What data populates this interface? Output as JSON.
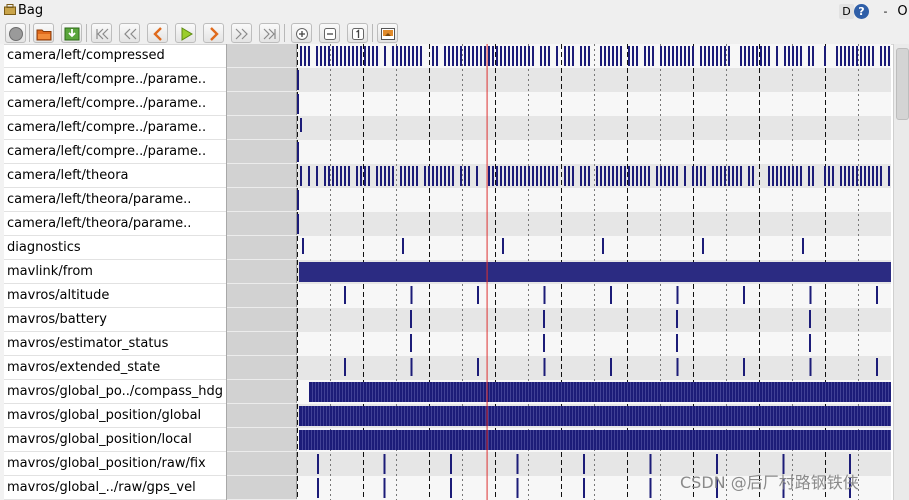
{
  "window": {
    "title": "Bag"
  },
  "title_buttons": [
    {
      "icon": "d-icon",
      "glyph": "D"
    },
    {
      "icon": "help-icon",
      "glyph": "?"
    },
    {
      "icon": "minimize-icon",
      "glyph": "-"
    },
    {
      "icon": "close-icon",
      "glyph": "O"
    }
  ],
  "toolbar": {
    "buttons": [
      {
        "name": "record-button",
        "icon": "record-icon"
      },
      {
        "name": "load-bag-button",
        "icon": "open-folder-icon"
      },
      {
        "name": "save-bag-button",
        "icon": "save-icon"
      },
      {
        "name": "go-to-beginning-button",
        "icon": "skip-to-start-icon"
      },
      {
        "name": "rewind-button",
        "icon": "rewind-icon"
      },
      {
        "name": "step-back-button",
        "icon": "step-back-icon"
      },
      {
        "name": "play-button",
        "icon": "play-icon"
      },
      {
        "name": "step-forward-button",
        "icon": "step-forward-icon"
      },
      {
        "name": "fast-forward-button",
        "icon": "fast-forward-icon"
      },
      {
        "name": "go-to-end-button",
        "icon": "skip-to-end-icon"
      },
      {
        "name": "zoom-in-button",
        "icon": "zoom-in-icon"
      },
      {
        "name": "zoom-out-button",
        "icon": "zoom-out-icon"
      },
      {
        "name": "zoom-reset-button",
        "icon": "zoom-reset-icon"
      },
      {
        "name": "thumbnails-button",
        "icon": "image-icon"
      }
    ]
  },
  "colors": {
    "message_mark": "#1c1c78",
    "playhead": "#dd3030",
    "row_light": "#f7f7f7",
    "row_dark": "#e6e6e6"
  },
  "topics": [
    {
      "name": "camera/left/compressed",
      "pattern": "dense-gappy"
    },
    {
      "name": "camera/left/compre../parame..",
      "pattern": "start"
    },
    {
      "name": "camera/left/compre../parame..",
      "pattern": "start"
    },
    {
      "name": "camera/left/compre../parame..",
      "pattern": "near-start"
    },
    {
      "name": "camera/left/compre../parame..",
      "pattern": "start"
    },
    {
      "name": "camera/left/theora",
      "pattern": "dense-gappy"
    },
    {
      "name": "camera/left/theora/parame..",
      "pattern": "start"
    },
    {
      "name": "camera/left/theora/parame..",
      "pattern": "start"
    },
    {
      "name": "diagnostics",
      "pattern": "periodic-100"
    },
    {
      "name": "mavlink/from",
      "pattern": "solid"
    },
    {
      "name": "mavros/altitude",
      "pattern": "periodic-66"
    },
    {
      "name": "mavros/battery",
      "pattern": "periodic-133"
    },
    {
      "name": "mavros/estimator_status",
      "pattern": "periodic-133"
    },
    {
      "name": "mavros/extended_state",
      "pattern": "periodic-66"
    },
    {
      "name": "mavros/global_po../compass_hdg",
      "pattern": "dense-late"
    },
    {
      "name": "mavros/global_position/global",
      "pattern": "dense"
    },
    {
      "name": "mavros/global_position/local",
      "pattern": "dense"
    },
    {
      "name": "mavros/global_position/raw/fix",
      "pattern": "periodic-66b"
    },
    {
      "name": "mavros/global_../raw/gps_vel",
      "pattern": "periodic-66b"
    }
  ],
  "playhead": {
    "position_fraction": 0.32
  },
  "watermark": "CSDN @后厂村路钢铁侠"
}
